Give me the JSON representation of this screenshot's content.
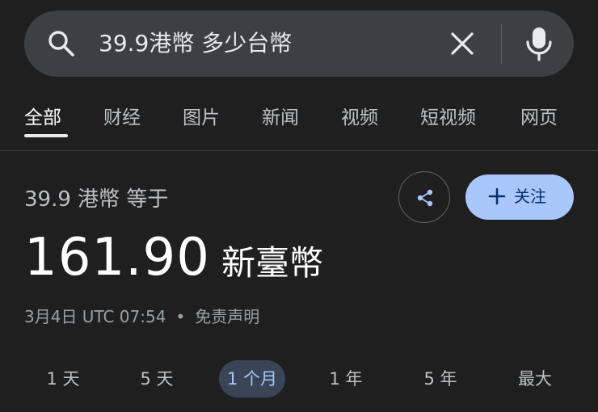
{
  "search": {
    "query": "39.9港幣 多少台幣"
  },
  "tabs": [
    {
      "label": "全部",
      "active": true
    },
    {
      "label": "财经"
    },
    {
      "label": "图片"
    },
    {
      "label": "新闻"
    },
    {
      "label": "视频"
    },
    {
      "label": "短视频"
    },
    {
      "label": "网页"
    }
  ],
  "converter": {
    "equals_text": "39.9 港幣 等于",
    "result_value": "161.90",
    "result_unit": "新臺幣",
    "timestamp": "3月4日 UTC 07:54",
    "separator": "•",
    "disclaimer": "免责声明",
    "follow_label": "关注"
  },
  "ranges": [
    {
      "label": "1 天"
    },
    {
      "label": "5 天"
    },
    {
      "label": "1 个月",
      "active": true
    },
    {
      "label": "1 年"
    },
    {
      "label": "5 年"
    },
    {
      "label": "最大"
    }
  ],
  "colors": {
    "background": "#1f1f1f",
    "searchbar": "#3c4043",
    "accent": "#a8c7fa"
  }
}
